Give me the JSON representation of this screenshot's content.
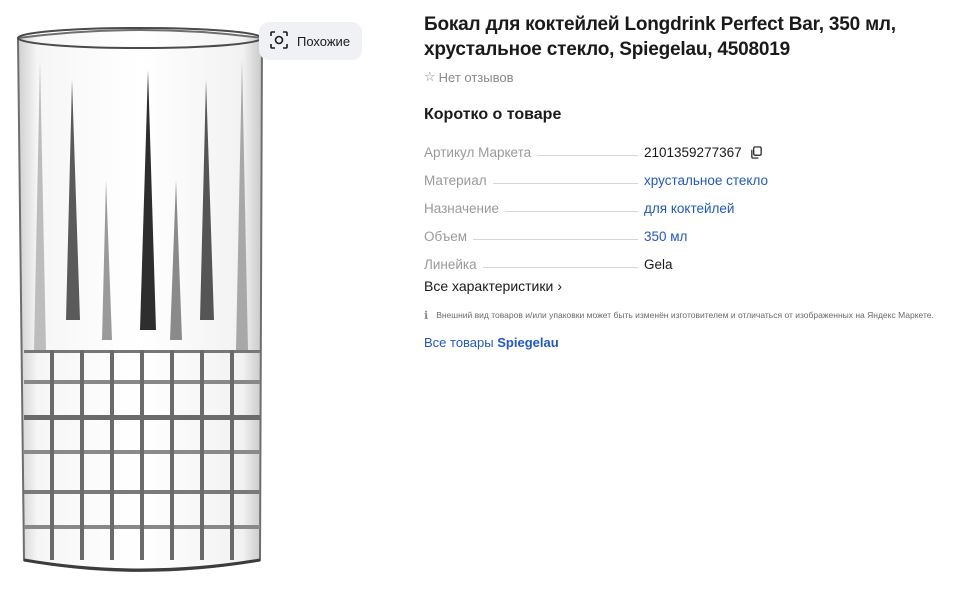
{
  "gallery": {
    "similar_label": "Похожие"
  },
  "product": {
    "title": "Бокал для коктейлей Longdrink Perfect Bar, 350 мл, хрустальное стекло, Spiegelau, 4508019",
    "reviews_star": "☆",
    "reviews_label": "Нет отзывов"
  },
  "summary": {
    "title": "Коротко о товаре",
    "specs": [
      {
        "label": "Артикул Маркета",
        "value": "2101359277367"
      },
      {
        "label": "Материал",
        "value": "хрустальное стекло"
      },
      {
        "label": "Назначение",
        "value": "для коктейлей"
      },
      {
        "label": "Объем",
        "value": "350 мл"
      },
      {
        "label": "Линейка",
        "value": "Gela"
      }
    ],
    "all_specs_label": "Все характеристики",
    "all_specs_chevron": "›"
  },
  "disclaimer": {
    "icon": "ℹ",
    "text": "Внешний вид товаров и/или упаковки может быть изменён изготовителем и отличаться от изображенных на Яндекс Маркете."
  },
  "brand": {
    "prefix": "Все товары",
    "name": "Spiegelau"
  }
}
